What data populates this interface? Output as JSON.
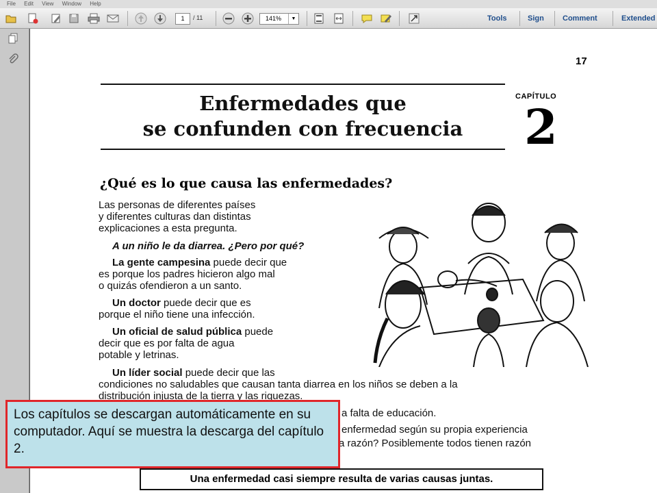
{
  "menu": {
    "items": [
      "File",
      "Edit",
      "View",
      "Window",
      "Help"
    ]
  },
  "toolbar": {
    "page_current": "1",
    "page_total": "/ 11",
    "zoom": "141%",
    "links": [
      "Tools",
      "Sign",
      "Comment",
      "Extended"
    ]
  },
  "document": {
    "page_number": "17",
    "title_line1": "Enfermedades que",
    "title_line2": "se confunden con frecuencia",
    "chapter_label": "CAPÍTULO",
    "chapter_number": "2",
    "heading": "¿Qué es lo que causa las enfermedades?",
    "intro": [
      "Las personas de diferentes países",
      "y diferentes culturas dan distintas",
      "explicaciones a esta pregunta."
    ],
    "question": "A un niño le da diarrea. ¿Pero por qué?",
    "campesina_bold": "La gente campesina",
    "campesina_rest1": " puede decir que",
    "campesina_rest2": "es porque los padres hicieron algo mal",
    "campesina_rest3": "o quizás ofendieron a un santo.",
    "doctor_bold": "Un doctor",
    "doctor_rest1": " puede decir que es",
    "doctor_rest2": "porque el niño tiene una infección.",
    "oficial_bold": "Un oficial de salud pública",
    "oficial_rest1": " puede",
    "oficial_rest2": "decir que es por falta de agua",
    "oficial_rest3": "potable y letrinas.",
    "lider_bold": "Un líder social",
    "lider_rest1": " puede decir que las",
    "lider_rest2": "condiciones no saludables que causan tanta diarrea en los niños se deben a la",
    "lider_rest3": "distribución injusta de la tierra y las riquezas.",
    "partial1": "a falta de educación.",
    "partial2": "enfermedad según su propia experiencia",
    "partial3": "a razón? Posiblemente todos tienen razón",
    "boxed": "Una enfermedad casi siempre resulta de varias causas juntas."
  },
  "callout": {
    "text": "Los capítulos se descargan automáticamente en su computador. Aquí se muestra la descarga del capítulo 2."
  }
}
